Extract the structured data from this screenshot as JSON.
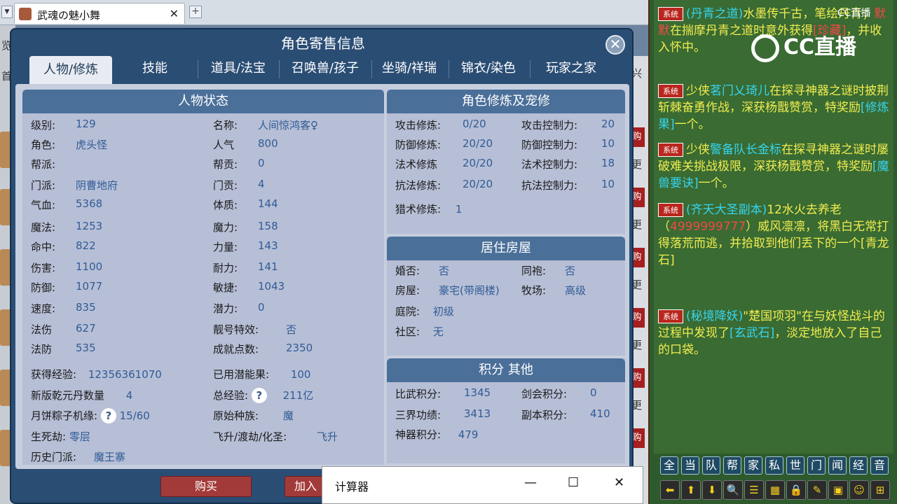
{
  "browser": {
    "tab_title": "武魂の魅小舞",
    "close_glyph": "✕",
    "new_tab_glyph": "+",
    "scroll_arrow_glyph": "▼"
  },
  "side": {
    "left_chars": [
      "览",
      "首"
    ],
    "right_chars": [
      "兴",
      "更",
      "更",
      "更",
      "更",
      "更",
      "更"
    ],
    "right_red": [
      "购",
      "购",
      "购",
      "购",
      "购",
      "购",
      "购",
      "购"
    ]
  },
  "dialog": {
    "title": "角色寄售信息",
    "close_glyph": "✕",
    "tabs": [
      "人物/修炼",
      "技能",
      "道具/法宝",
      "召唤兽/孩子",
      "坐骑/祥瑞",
      "锦衣/染色",
      "玩家之家"
    ],
    "active_tab": 0
  },
  "status": {
    "title": "人物状态",
    "left": [
      [
        "级别:",
        "129"
      ],
      [
        "角色:",
        "虎头怪"
      ],
      [
        "帮派:",
        ""
      ],
      [
        "门派:",
        "阴曹地府"
      ],
      [
        "气血:",
        "5368"
      ],
      [
        "魔法:",
        "1253"
      ],
      [
        "命中:",
        "822"
      ],
      [
        "伤害:",
        "1100"
      ],
      [
        "防御:",
        "1077"
      ],
      [
        "速度:",
        "835"
      ],
      [
        "法伤",
        "627"
      ],
      [
        "法防",
        "535"
      ]
    ],
    "right": [
      [
        "名称:",
        "人间惊鸿客♀"
      ],
      [
        "人气",
        "800"
      ],
      [
        "帮贡:",
        "0"
      ],
      [
        "门贡:",
        "4"
      ],
      [
        "体质:",
        "144"
      ],
      [
        "魔力:",
        "158"
      ],
      [
        "力量:",
        "143"
      ],
      [
        "耐力:",
        "141"
      ],
      [
        "敏捷:",
        "1043"
      ],
      [
        "潜力:",
        "0"
      ],
      [
        "靓号特效:",
        "否"
      ],
      [
        "成就点数:",
        "2350"
      ]
    ],
    "exp_label": "获得经验:",
    "exp_value": "12356361070",
    "qianyuan_label": "新版乾元丹数量",
    "qianyuan_value": "4",
    "mooncake_label": "月饼粽子机缘:",
    "mooncake_value": "15/60",
    "shengsi_label": "生死劫:",
    "shengsi_value": "零层",
    "history_label": "历史门派:",
    "history_value": "魔王寨",
    "used_label": "已用潜能果:",
    "used_value": "100",
    "total_exp_label": "总经验:",
    "total_exp_value": "211亿",
    "race_label": "原始种族:",
    "race_value": "魔",
    "fly_label": "飞升/渡劫/化圣:",
    "fly_value": "飞升",
    "question_glyph": "?"
  },
  "cultivation": {
    "title": "角色修炼及宠修",
    "rows": [
      [
        "攻击修炼:",
        "0/20",
        "攻击控制力:",
        "20"
      ],
      [
        "防御修炼:",
        "20/20",
        "防御控制力:",
        "10"
      ],
      [
        "法术修炼",
        "20/20",
        "法术控制力:",
        "18"
      ],
      [
        "抗法修炼:",
        "20/20",
        "抗法控制力:",
        "10"
      ]
    ],
    "hunt_label": "猎术修炼:",
    "hunt_value": "1"
  },
  "house": {
    "title": "居住房屋",
    "rows": [
      [
        "婚否:",
        "否",
        "同袍:",
        "否"
      ],
      [
        "房屋:",
        "豪宅(带阁楼)",
        "牧场:",
        "高级"
      ]
    ],
    "yard_label": "庭院:",
    "yard_value": "初级",
    "community_label": "社区:",
    "community_value": "无"
  },
  "score": {
    "title": "积分 其他",
    "rows": [
      [
        "比武积分:",
        "1345",
        "剑会积分:",
        "0"
      ],
      [
        "三界功绩:",
        "3413",
        "副本积分:",
        "410"
      ]
    ],
    "artifact_label": "神器积分:",
    "artifact_value": "479"
  },
  "buttons": {
    "buy": "购买",
    "join": "加入"
  },
  "calculator": {
    "title": "计算器",
    "minimize": "—",
    "maximize": "☐",
    "close": "✕"
  },
  "chat": {
    "logo_text": "CC直播",
    "logo_small": "CC直播",
    "sys_tag": "系统",
    "msg1_a": "(丹青之道)",
    "msg1_b": "水墨传千古，笔绘丹青；",
    "msg1_c": "默默",
    "msg1_d": "在揣摩丹青之道时意外获得",
    "msg1_e": "[珍藏]",
    "msg1_f": "，并收入怀中。",
    "msg2_a": "少侠",
    "msg2_b": "茗门乂琦儿",
    "msg2_c": "在探寻神器之谜时披荆斩棘奋勇作战，深获杨戬赞赏，特奖励",
    "msg2_d": "[修炼果]",
    "msg2_e": "一个。",
    "msg3_a": "少侠",
    "msg3_b": "警备队长金标",
    "msg3_c": "在探寻神器之谜时屡破难关挑战极限，深获杨戬赞赏，特奖励",
    "msg3_d": "[魔兽要诀]",
    "msg3_e": "一个。",
    "msg4_a": "(齐天大圣副本)",
    "msg4_b": "12水火去养老",
    "msg4_c": "（",
    "msg4_d": "4999999777",
    "msg4_e": "）威风凛凛，将黑白无常打得落荒而逃，并拾取到他们丢下的一个",
    "msg4_f": "[青龙石]",
    "msg5_a": "(秘境降妖)",
    "msg5_b": "\"楚国项羽\"",
    "msg5_c": "在与妖怪战斗的过程中发现了",
    "msg5_d": "[玄武石]",
    "msg5_e": "，淡定地放入了自己的口袋。",
    "channels": [
      "全",
      "当",
      "队",
      "帮",
      "家",
      "私",
      "世",
      "门",
      "闻",
      "经",
      "音"
    ],
    "tools": [
      "⬅",
      "⬆",
      "⬇",
      "🔍",
      "☰",
      "▦",
      "🔒",
      "✎",
      "▣",
      "☺",
      "⊞"
    ]
  }
}
